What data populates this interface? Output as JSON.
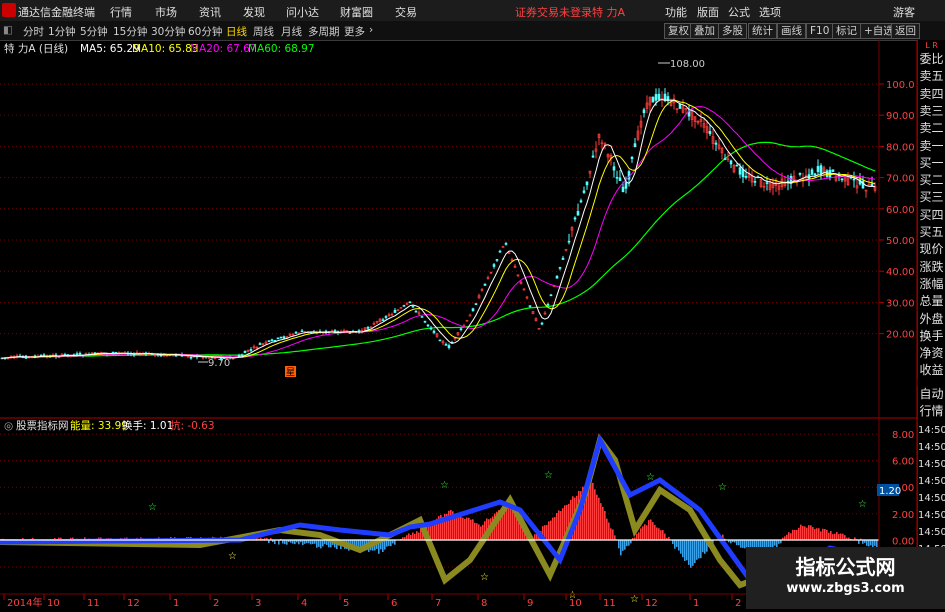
{
  "app": {
    "title": "通达信金融终端"
  },
  "menu": {
    "items": [
      "行情",
      "市场",
      "资讯",
      "发现",
      "问小达",
      "财富圈",
      "交易"
    ],
    "status": "证券交易未登录",
    "stock": "特 力A",
    "right_items": [
      "功能",
      "版面",
      "公式",
      "选项"
    ],
    "guest": "游客"
  },
  "toolbar": {
    "periods": [
      "分时",
      "1分钟",
      "5分钟",
      "15分钟",
      "30分钟",
      "60分钟",
      "日线",
      "周线",
      "月线",
      "多周期",
      "更多"
    ],
    "active_period": "日线",
    "right_buttons": [
      "复权",
      "叠加",
      "多股",
      "统计",
      "画线",
      "F10",
      "标记",
      "+自选",
      "返回"
    ]
  },
  "main_legend": {
    "title": "特 力A (日线)",
    "ma5": "MA5: 65.29",
    "ma10": "MA10: 65.83",
    "ma20": "MA20: 67.67",
    "ma60": "MA60: 68.97"
  },
  "price_axis": {
    "labels": [
      "100.0",
      "90.00",
      "80.00",
      "70.00",
      "60.00",
      "50.00",
      "40.00",
      "30.00",
      "20.00"
    ]
  },
  "annotations": {
    "high": "108.00",
    "low": "9.70",
    "marker": "星"
  },
  "indicator_legend": {
    "name": "股票指标网",
    "energy": "能量: 33.99",
    "turnover": "换手: 1.01",
    "kang": "抗: -0.63"
  },
  "indicator_axis": {
    "labels": [
      "8.00",
      "6.00",
      "4.00",
      "2.00",
      "0.00",
      "-2.00"
    ],
    "current": "1.20"
  },
  "time_axis": {
    "labels": [
      "2014年",
      "10",
      "11",
      "12",
      "1",
      "2",
      "3",
      "4",
      "5",
      "6",
      "7",
      "8",
      "9",
      "10",
      "11",
      "12",
      "1",
      "2"
    ]
  },
  "right_sidebar": {
    "corner": "L R",
    "items": [
      "委比",
      "卖五",
      "卖四",
      "卖三",
      "卖二",
      "卖一",
      "买一",
      "买二",
      "买三",
      "买四",
      "买五",
      "现价",
      "涨跌",
      "涨幅",
      "总量",
      "外盘",
      "换手",
      "净资",
      "收益"
    ],
    "lower_items": [
      "自动",
      "行情"
    ],
    "times": [
      "14:50",
      "14:50",
      "14:50",
      "14:50",
      "14:50",
      "14:50",
      "14:50",
      "14:50"
    ]
  },
  "watermark": {
    "title": "指标公式网",
    "url": "www.zbgs3.com"
  },
  "colors": {
    "ma5": "#ffffff",
    "ma10": "#ffff00",
    "ma20": "#ff00ff",
    "ma60": "#00ff00",
    "up": "#ff3c3c",
    "down": "#54ffff",
    "grid": "#7a0000"
  }
}
